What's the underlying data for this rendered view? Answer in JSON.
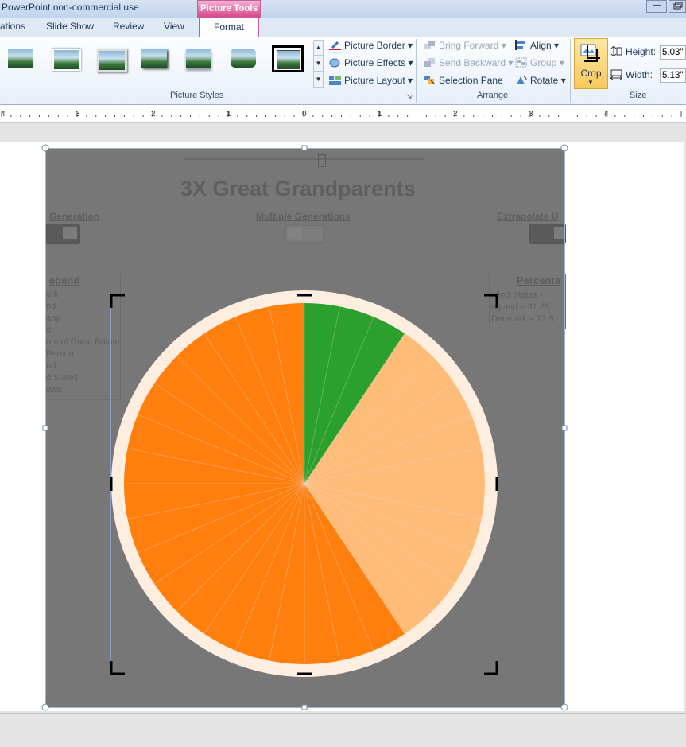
{
  "title_bar": {
    "app_title": "PowerPoint non-commercial use",
    "context_tab_header": "Picture Tools",
    "window_buttons": [
      "minimize-icon",
      "restore-icon"
    ]
  },
  "tabs": {
    "animations": "ations",
    "slide_show": "Slide Show",
    "review": "Review",
    "view": "View",
    "format": "Format"
  },
  "ribbon": {
    "picture_styles": {
      "label": "Picture Styles",
      "gallery_thumbnail_count": 7,
      "selected_index": 6,
      "border": "Picture Border",
      "effects": "Picture Effects",
      "layout": "Picture Layout"
    },
    "arrange": {
      "label": "Arrange",
      "bring_forward": "Bring Forward",
      "send_backward": "Send Backward",
      "selection_pane": "Selection Pane",
      "align": "Align",
      "group": "Group",
      "rotate": "Rotate"
    },
    "size": {
      "label": "Size",
      "crop": "Crop",
      "height_label": "Height:",
      "height_value": "5.03\"",
      "width_label": "Width:",
      "width_value": "5.13\""
    }
  },
  "ruler": {
    "numbers": [
      "4",
      "3",
      "2",
      "1",
      "0",
      "1",
      "2",
      "3",
      "4"
    ]
  },
  "slide_ghost": {
    "title": "3X Great Grandparents",
    "generation": "Generation",
    "multiple_generations": "Multiple Generations",
    "extrapolate": "Extrapolate U",
    "legend_title": "egend",
    "legend_items": [
      "ark",
      "nd",
      "any",
      "d",
      "om of Great Britain",
      "Person",
      "nd",
      "d States",
      "own"
    ],
    "percent_title": "Percenta",
    "percent_items": [
      "nited States -",
      "ngland = 31.25",
      "Denmark = 12.5"
    ]
  },
  "pie": {
    "slice_count": 32,
    "colors": {
      "ring": "#fdeee0",
      "dark_orange": "#ff7f0e",
      "green": "#2ca02c",
      "light_orange": "#ffbb78",
      "divider": "#e6e6e6"
    },
    "slices": [
      {
        "name": "green",
        "count": 3,
        "color": "#2ca02c"
      },
      {
        "name": "light-orange",
        "count": 10,
        "color": "#ffbb78"
      },
      {
        "name": "dark-orange",
        "count": 19,
        "color": "#ff7f0e"
      }
    ]
  }
}
